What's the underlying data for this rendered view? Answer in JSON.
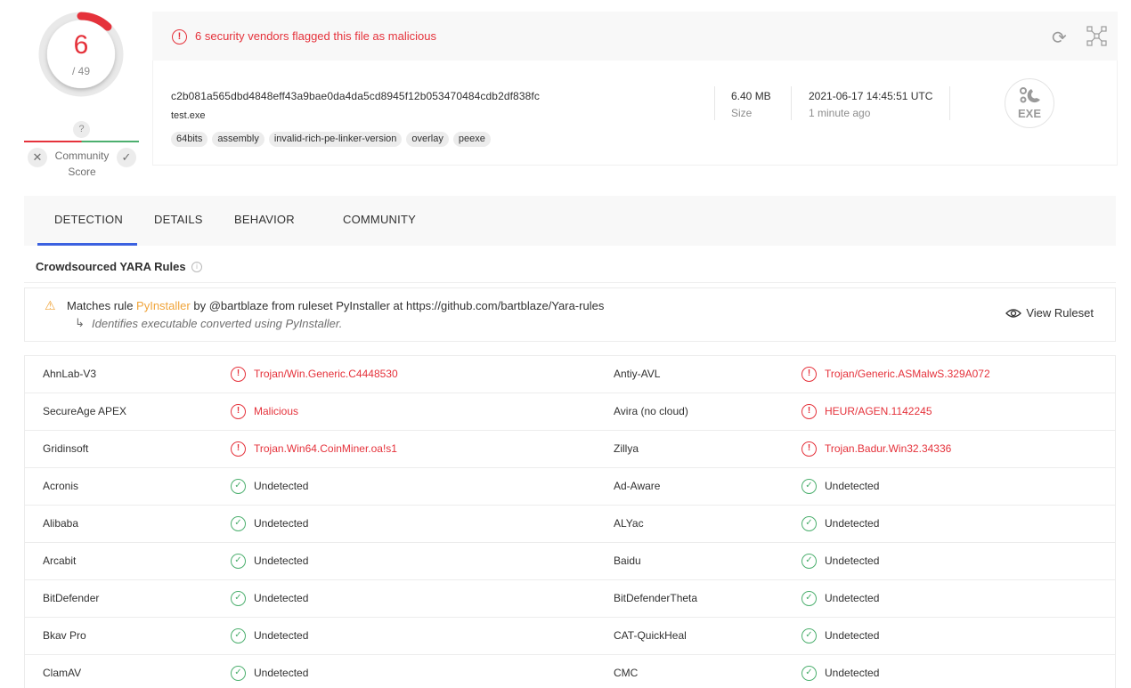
{
  "score": {
    "detected": "6",
    "total": "/ 49",
    "detected_fraction": 0.1224
  },
  "community": {
    "question": "?",
    "label_line1": "Community",
    "label_line2": "Score"
  },
  "alert": {
    "text": "6 security vendors flagged this file as malicious"
  },
  "file": {
    "hash": "c2b081a565dbd4848eff43a9bae0da4da5cd8945f12b053470484cdb2df838fc",
    "name": "test.exe",
    "tags": [
      "64bits",
      "assembly",
      "invalid-rich-pe-linker-version",
      "overlay",
      "peexe"
    ],
    "size": "6.40 MB",
    "size_label": "Size",
    "date": "2021-06-17 14:45:51 UTC",
    "date_relative": "1 minute ago",
    "type_icon": "EXE"
  },
  "tabs": [
    "DETECTION",
    "DETAILS",
    "BEHAVIOR",
    "COMMUNITY"
  ],
  "yara": {
    "title": "Crowdsourced YARA Rules",
    "prefix": "Matches rule",
    "rule": "PyInstaller",
    "suffix": "by @bartblaze from ruleset PyInstaller at https://github.com/bartblaze/Yara-rules",
    "description": "Identifies executable converted using PyInstaller.",
    "view_button": "View Ruleset"
  },
  "detections": [
    {
      "left_engine": "AhnLab-V3",
      "left_result": "Trojan/Win.Generic.C4448530",
      "left_status": "mal",
      "right_engine": "Antiy-AVL",
      "right_result": "Trojan/Generic.ASMalwS.329A072",
      "right_status": "mal"
    },
    {
      "left_engine": "SecureAge APEX",
      "left_result": "Malicious",
      "left_status": "mal",
      "right_engine": "Avira (no cloud)",
      "right_result": "HEUR/AGEN.1142245",
      "right_status": "mal"
    },
    {
      "left_engine": "Gridinsoft",
      "left_result": "Trojan.Win64.CoinMiner.oa!s1",
      "left_status": "mal",
      "right_engine": "Zillya",
      "right_result": "Trojan.Badur.Win32.34336",
      "right_status": "mal"
    },
    {
      "left_engine": "Acronis",
      "left_result": "Undetected",
      "left_status": "ok",
      "right_engine": "Ad-Aware",
      "right_result": "Undetected",
      "right_status": "ok"
    },
    {
      "left_engine": "Alibaba",
      "left_result": "Undetected",
      "left_status": "ok",
      "right_engine": "ALYac",
      "right_result": "Undetected",
      "right_status": "ok"
    },
    {
      "left_engine": "Arcabit",
      "left_result": "Undetected",
      "left_status": "ok",
      "right_engine": "Baidu",
      "right_result": "Undetected",
      "right_status": "ok"
    },
    {
      "left_engine": "BitDefender",
      "left_result": "Undetected",
      "left_status": "ok",
      "right_engine": "BitDefenderTheta",
      "right_result": "Undetected",
      "right_status": "ok"
    },
    {
      "left_engine": "Bkav Pro",
      "left_result": "Undetected",
      "left_status": "ok",
      "right_engine": "CAT-QuickHeal",
      "right_result": "Undetected",
      "right_status": "ok"
    },
    {
      "left_engine": "ClamAV",
      "left_result": "Undetected",
      "left_status": "ok",
      "right_engine": "CMC",
      "right_result": "Undetected",
      "right_status": "ok"
    }
  ],
  "colors": {
    "malicious": "#e5323b",
    "clean": "#4caf6e",
    "accent": "#3b61e0",
    "warning": "#f0a43a"
  }
}
